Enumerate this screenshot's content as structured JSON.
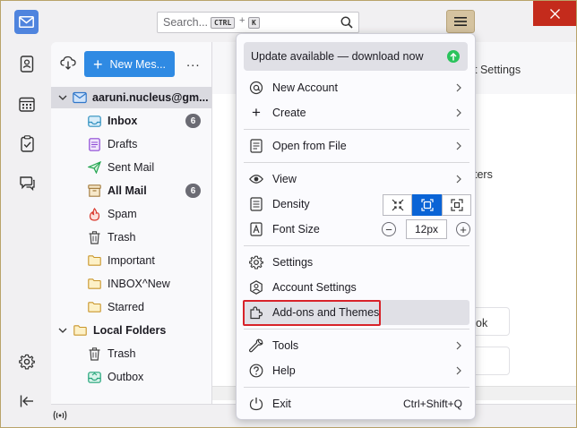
{
  "search": {
    "placeholder": "Search...",
    "key1": "CTRL",
    "plus": "+",
    "key2": "K"
  },
  "folder_pane": {
    "new_message_label": "New Mes...",
    "more_label": "...",
    "account_name": "aaruni.nucleus@gm...",
    "folders": [
      {
        "label": "Inbox",
        "bold": true,
        "badge": "6",
        "icon": "inbox-icon"
      },
      {
        "label": "Drafts",
        "bold": false,
        "icon": "drafts-icon"
      },
      {
        "label": "Sent Mail",
        "bold": false,
        "icon": "sent-icon"
      },
      {
        "label": "All Mail",
        "bold": true,
        "badge": "6",
        "icon": "archive-icon"
      },
      {
        "label": "Spam",
        "bold": false,
        "icon": "spam-icon"
      },
      {
        "label": "Trash",
        "bold": false,
        "icon": "trash-icon"
      },
      {
        "label": "Important",
        "bold": false,
        "icon": "folder-icon"
      },
      {
        "label": "INBOX^New",
        "bold": false,
        "icon": "folder-icon"
      },
      {
        "label": "Starred",
        "bold": false,
        "icon": "folder-icon"
      }
    ],
    "local_folders_label": "Local Folders",
    "local_folders": [
      {
        "label": "Trash",
        "icon": "trash-icon"
      },
      {
        "label": "Outbox",
        "icon": "outbox-icon"
      }
    ]
  },
  "main": {
    "partial_text_1": "t Settings",
    "partial_text_2": "ters",
    "partial_text_3": "ok"
  },
  "app_menu": {
    "update_banner": "Update available — download now",
    "items": {
      "new_account": "New Account",
      "create": "Create",
      "open_from_file": "Open from File",
      "view": "View",
      "density": "Density",
      "font_size": "Font Size",
      "font_size_value": "12px",
      "settings": "Settings",
      "account_settings": "Account Settings",
      "addons_themes": "Add-ons and Themes",
      "tools": "Tools",
      "help": "Help",
      "exit": "Exit",
      "exit_shortcut": "Ctrl+Shift+Q"
    },
    "density_selected": "normal"
  },
  "colors": {
    "accent": "#2f8ae3",
    "highlight_box": "#d8232a",
    "close_button": "#c42b1c",
    "update_dot": "#2ac35c"
  }
}
